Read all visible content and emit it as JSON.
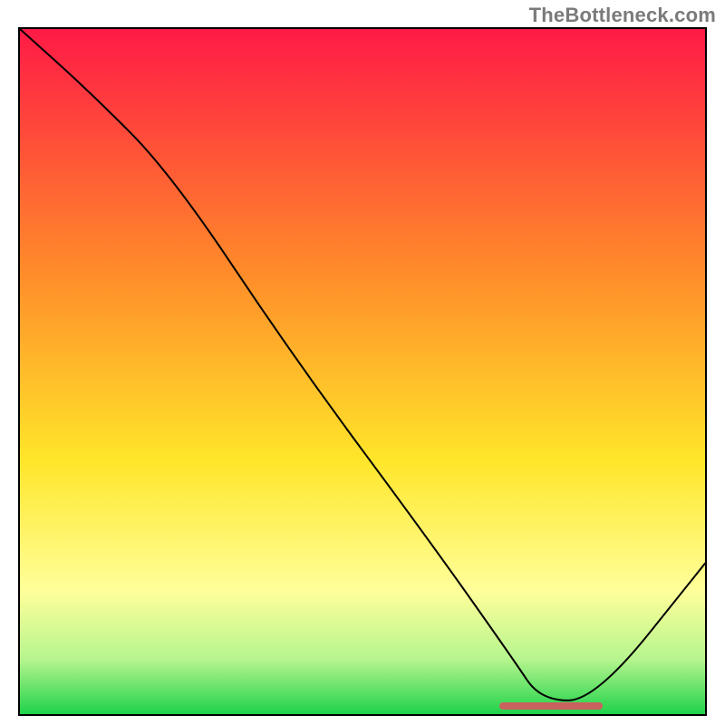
{
  "watermark": {
    "text": "TheBottleneck.com"
  },
  "colors": {
    "red": "#ff1a46",
    "orange": "#ff8a2a",
    "yellow": "#ffe62a",
    "pale_yellow": "#ffff9a",
    "pale_green": "#b6f58e",
    "green": "#1fd24a",
    "marker": "#c9615e",
    "curve": "#000000",
    "frame": "#000000"
  },
  "chart_data": {
    "type": "line",
    "title": "",
    "xlabel": "",
    "ylabel": "",
    "xlim": [
      0,
      100
    ],
    "ylim": [
      0,
      100
    ],
    "grid": false,
    "legend": false,
    "description": "Bottleneck-style curve over vertical red→yellow→green gradient; curve descends from upper-left corner, slight knee near x≈22, steep linear decline to a flat minimum around x≈80, then rises toward the right edge. A short horizontal marker sits at the flat minimum.",
    "series": [
      {
        "name": "curve",
        "x": [
          0,
          10,
          22,
          40,
          60,
          72,
          76,
          84,
          100
        ],
        "y": [
          100,
          91,
          79,
          52,
          25,
          8,
          2,
          2,
          22
        ]
      }
    ],
    "marker": {
      "x_start": 70,
      "x_end": 85,
      "y": 1.2
    },
    "gradient_stops": [
      {
        "pct": 0,
        "color_key": "red"
      },
      {
        "pct": 35,
        "color_key": "orange"
      },
      {
        "pct": 63,
        "color_key": "yellow"
      },
      {
        "pct": 82,
        "color_key": "pale_yellow"
      },
      {
        "pct": 92,
        "color_key": "pale_green"
      },
      {
        "pct": 100,
        "color_key": "green"
      }
    ]
  }
}
